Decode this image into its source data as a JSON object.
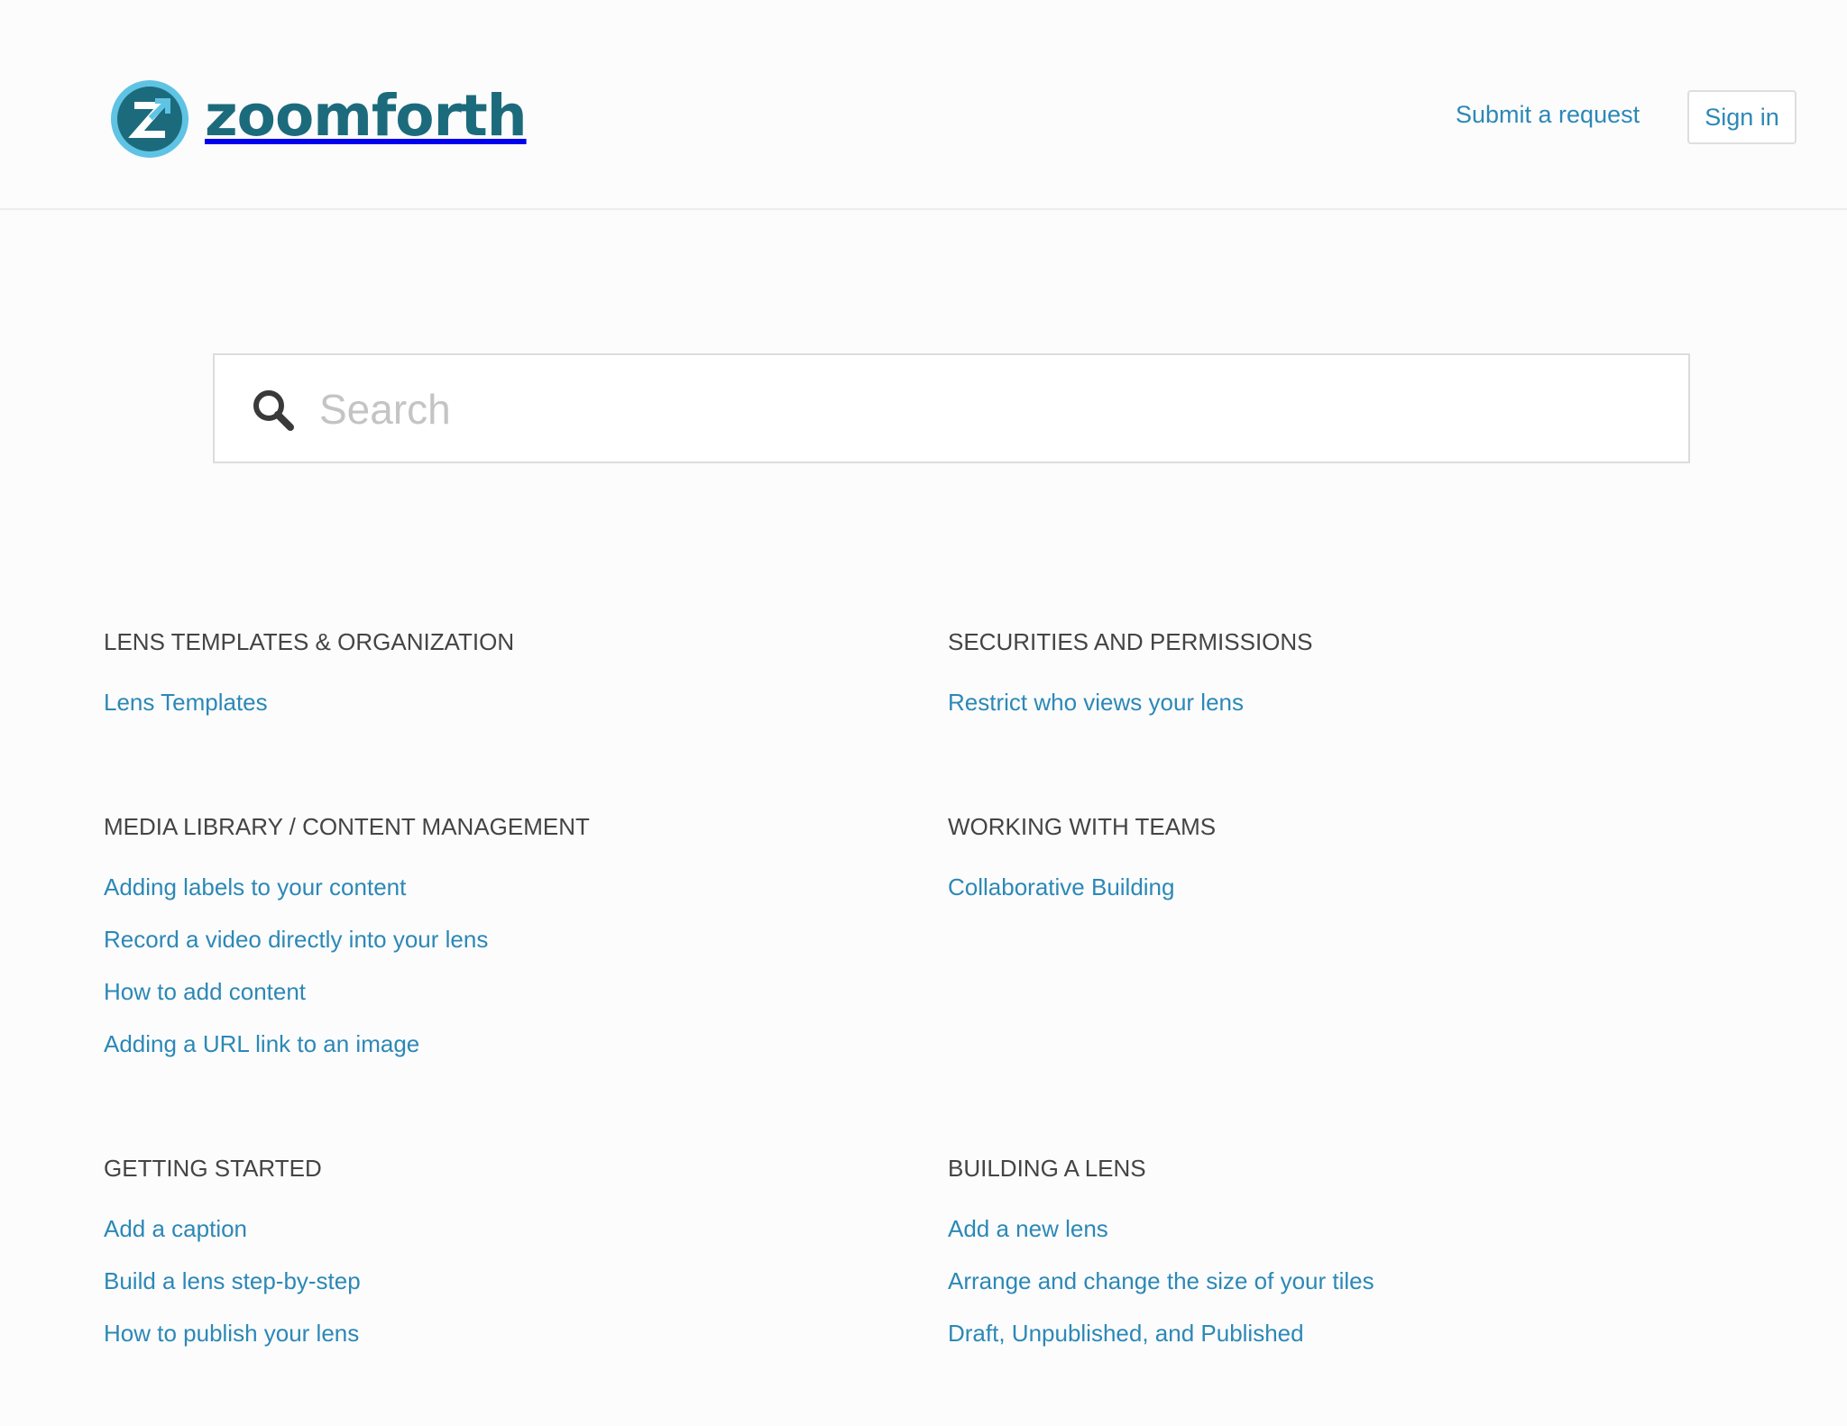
{
  "brand": {
    "name": "zoomforth",
    "mark_letter": "Z",
    "color": "#1c6b7c",
    "accent": "#5fc3e4"
  },
  "header": {
    "submit_request": "Submit a request",
    "sign_in": "Sign in"
  },
  "search": {
    "placeholder": "Search",
    "value": ""
  },
  "colors": {
    "link": "#2c88b6",
    "heading": "#444444",
    "background": "#fcfcfd"
  },
  "sections": [
    {
      "title": "LENS TEMPLATES & ORGANIZATION",
      "articles": [
        "Lens Templates"
      ]
    },
    {
      "title": "SECURITIES AND PERMISSIONS",
      "articles": [
        "Restrict who views your lens"
      ]
    },
    {
      "title": "MEDIA LIBRARY / CONTENT MANAGEMENT",
      "articles": [
        "Adding labels to your content",
        "Record a video directly into your lens",
        "How to add content",
        "Adding a URL link to an image"
      ]
    },
    {
      "title": "WORKING WITH TEAMS",
      "articles": [
        "Collaborative Building"
      ]
    },
    {
      "title": "GETTING STARTED",
      "articles": [
        "Add a caption",
        "Build a lens step-by-step",
        "How to publish your lens"
      ]
    },
    {
      "title": "BUILDING A LENS",
      "articles": [
        "Add a new lens",
        "Arrange and change the size of your tiles",
        "Draft, Unpublished, and Published"
      ]
    }
  ]
}
